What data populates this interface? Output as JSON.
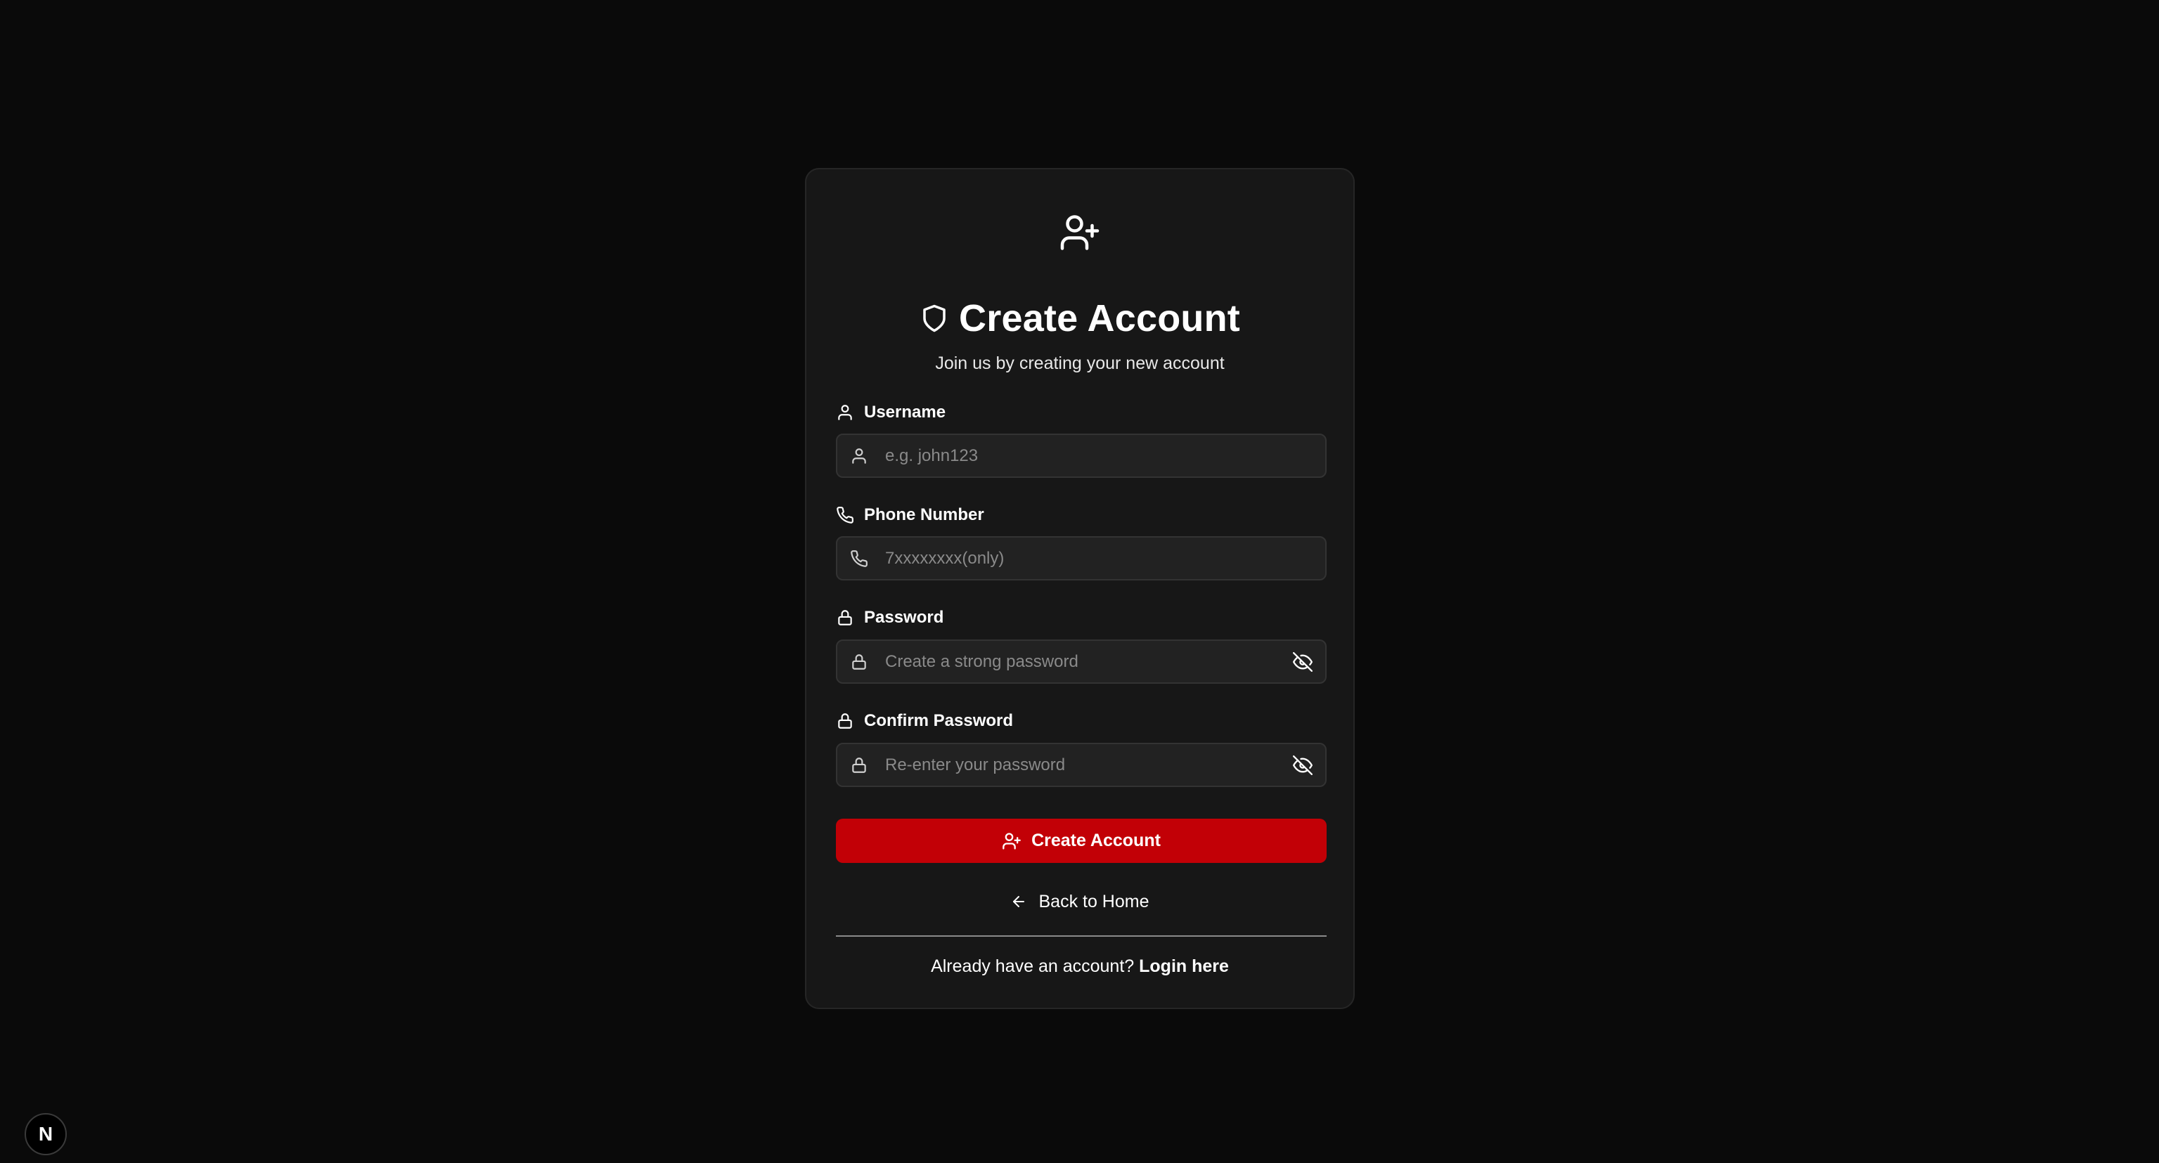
{
  "header": {
    "hero_icon": "user-plus-icon",
    "title_icon": "shield-icon",
    "title": "Create Account",
    "subtitle": "Join us by creating your new account"
  },
  "form": {
    "username": {
      "label": "Username",
      "placeholder": "e.g. john123",
      "value": "",
      "icon": "user-icon"
    },
    "phone": {
      "label": "Phone Number",
      "placeholder": "7xxxxxxxx(only)",
      "value": "",
      "icon": "phone-icon"
    },
    "password": {
      "label": "Password",
      "placeholder": "Create a strong password",
      "value": "",
      "icon": "lock-icon",
      "toggle_icon": "eye-off-icon"
    },
    "confirm_password": {
      "label": "Confirm Password",
      "placeholder": "Re-enter your password",
      "value": "",
      "icon": "lock-icon",
      "toggle_icon": "eye-off-icon"
    },
    "submit_label": "Create Account"
  },
  "footer": {
    "back_label": "Back to Home",
    "login_prompt": "Already have an account?",
    "login_link": "Login here"
  },
  "badge": {
    "letter": "N"
  },
  "colors": {
    "background": "#0a0a0a",
    "card": "#171717",
    "input": "#222222",
    "accent": "#c20006",
    "placeholder": "#8a8a8a"
  }
}
